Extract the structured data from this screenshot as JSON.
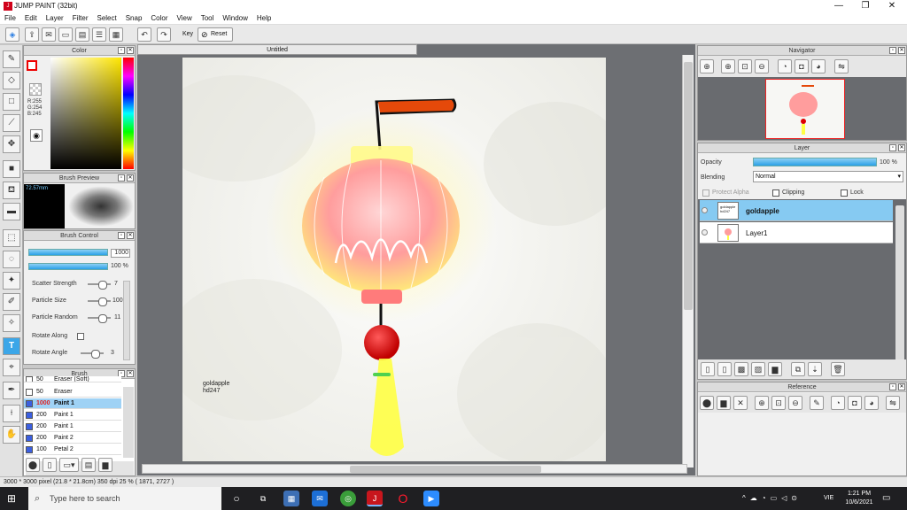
{
  "window": {
    "title": "JUMP PAINT (32bit)",
    "minimize": "—",
    "restore": "❐",
    "close": "✕"
  },
  "menu": [
    "File",
    "Edit",
    "Layer",
    "Filter",
    "Select",
    "Snap",
    "Color",
    "View",
    "Tool",
    "Window",
    "Help"
  ],
  "toolbar": {
    "key_label": "Key",
    "reset_label": "Reset"
  },
  "color_panel": {
    "title": "Color",
    "r": "R:255",
    "g": "G:254",
    "b": "B:245"
  },
  "brush_preview": {
    "title": "Brush Preview",
    "size": "72.57mm"
  },
  "brush_control": {
    "title": "Brush Control",
    "size_value": "1000",
    "opacity_value": "100 %",
    "params": [
      {
        "label": "Scatter Strength",
        "value": "7"
      },
      {
        "label": "Particle Size",
        "value": "100"
      },
      {
        "label": "Particle Random",
        "value": "11"
      },
      {
        "label": "Rotate Along",
        "value": ""
      },
      {
        "label": "Rotate Angle",
        "value": "3"
      }
    ]
  },
  "brush_panel": {
    "title": "Brush",
    "items": [
      {
        "size": "50",
        "name": "Eraser (Soft)",
        "color": "#ffffff"
      },
      {
        "size": "50",
        "name": "Eraser",
        "color": "#ffffff"
      },
      {
        "size": "1000",
        "name": "Paint 1",
        "color": "#3b5fe0",
        "selected": true
      },
      {
        "size": "200",
        "name": "Paint 1",
        "color": "#3b5fe0"
      },
      {
        "size": "200",
        "name": "Paint 1",
        "color": "#3b5fe0"
      },
      {
        "size": "200",
        "name": "Paint 2",
        "color": "#3b5fe0"
      },
      {
        "size": "100",
        "name": "Petal 2",
        "color": "#3b5fe0"
      }
    ]
  },
  "document": {
    "tab": "Untitled",
    "signature_1": "goldapple",
    "signature_2": "hd247"
  },
  "navigator": {
    "title": "Navigator"
  },
  "layer_panel": {
    "title": "Layer",
    "opacity_label": "Opacity",
    "opacity_value": "100 %",
    "blending_label": "Blending",
    "blending_value": "Normal",
    "protect_alpha": "Protect Alpha",
    "clipping": "Clipping",
    "lock": "Lock",
    "layers": [
      {
        "name": "goldapple",
        "thumb": "goldapple hd247",
        "selected": true
      },
      {
        "name": "Layer1",
        "thumb": "",
        "selected": false
      }
    ]
  },
  "reference": {
    "title": "Reference"
  },
  "status": {
    "text": "3000 * 3000 pixel   (21.8 * 21.8cm)   350 dpi   25 %   ( 1871, 2727 )"
  },
  "taskbar": {
    "search_placeholder": "Type here to search",
    "time": "1:21 PM",
    "date": "10/6/2021",
    "lang": "VIE"
  }
}
